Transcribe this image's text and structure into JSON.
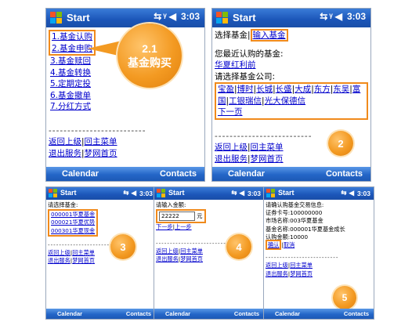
{
  "common": {
    "title": "Start",
    "time": "3:03",
    "softkey_left": "Calendar",
    "softkey_right": "Contacts"
  },
  "screen1": {
    "menu": [
      "1.基金认购",
      "2.基金申购",
      "3.基金赎回",
      "4.基金转换",
      "5.定期定投",
      "6.基金撤单",
      "7.分红方式"
    ],
    "dashes": "--------------------------",
    "back_label": "返回上级",
    "main_menu_label": "回主菜单",
    "exit_label": "退出服务",
    "home_label": "梦网首页",
    "separator": "|",
    "callout_number": "2.1",
    "callout_text": "基金购买"
  },
  "screen2": {
    "select_fund_label": "选择基金",
    "input_fund_link": "输入基金",
    "recent_label": "您最近认购的基金:",
    "recent_fund": "华夏红利前",
    "select_company_label": "请选择基金公司:",
    "companies": [
      "宝盈",
      "博时",
      "长城",
      "长盛",
      "大成",
      "东方",
      "东吴",
      "富国",
      "工银瑞信",
      "光大保德信"
    ],
    "next_page": "下一页",
    "dashes": "--------------------------",
    "back_label": "返回上级",
    "main_menu_label": "回主菜单",
    "exit_label": "退出服务",
    "home_label": "梦网首页",
    "separator": "|",
    "badge": "2"
  },
  "screen3": {
    "prompt": "请选择基金:",
    "funds": [
      "000001华夏基金",
      "000021华夏优势",
      "000301华夏现金"
    ],
    "dashes": "--------------------------",
    "back_label": "返回上级",
    "main_menu_label": "回主菜单",
    "exit_label": "退出服务",
    "home_label": "梦网首页",
    "separator": "|",
    "badge": "3"
  },
  "screen4": {
    "prompt": "请输入金额:",
    "amount_value": "22222",
    "unit": "元",
    "next_label": "下一步",
    "prev_label": "上一步",
    "dashes": "--------------------------",
    "back_label": "返回上级",
    "main_menu_label": "回主菜单",
    "exit_label": "退出服务",
    "home_label": "梦网首页",
    "separator": "|",
    "badge": "4"
  },
  "screen5": {
    "header": "请确认购基金交易信息:",
    "lines": [
      "证券卡号:100000000",
      "市场名称:003华夏基金",
      "基金名称:000001华夏基金成长",
      "认购金额:10000"
    ],
    "confirm_label": "确认",
    "cancel_label": "取消",
    "dashes": "--------------------------",
    "back_label": "返回上级",
    "main_menu_label": "回主菜单",
    "exit_label": "退出服务",
    "home_label": "梦网首页",
    "separator": "|",
    "badge": "5"
  },
  "colors": {
    "accent_orange": "#f08a1c",
    "link_blue": "#0000cc",
    "titlebar_blue": "#1b55b8"
  },
  "icons": [
    "windows-logo-icon",
    "connectivity-icon",
    "signal-icon",
    "speaker-icon"
  ]
}
